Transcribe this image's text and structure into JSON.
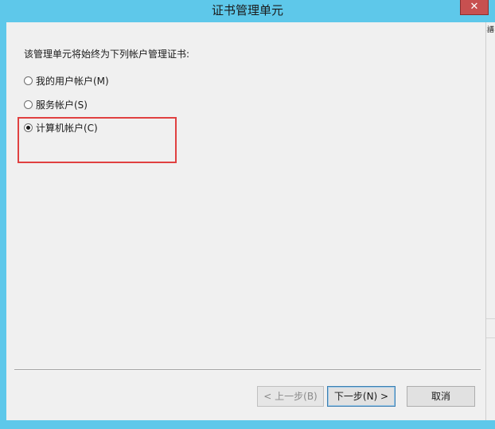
{
  "window": {
    "title": "证书管理单元",
    "close_glyph": "✕"
  },
  "side_glyph": "譜",
  "dialog": {
    "instruction": "该管理单元将始终为下列帐户管理证书:",
    "options": [
      {
        "label": "我的用户帐户(M)",
        "checked": false
      },
      {
        "label": "服务帐户(S)",
        "checked": false
      },
      {
        "label": "计算机帐户(C)",
        "checked": true
      }
    ]
  },
  "buttons": {
    "back": "< 上一步(B)",
    "next": "下一步(N) >",
    "cancel": "取消"
  },
  "colors": {
    "titlebar": "#5ec8ea",
    "close_button": "#c75050",
    "highlight_border": "#e04040",
    "dialog_background": "#f0f0f0"
  },
  "icons": {
    "close": "close-icon",
    "radio": "radio-icon"
  }
}
